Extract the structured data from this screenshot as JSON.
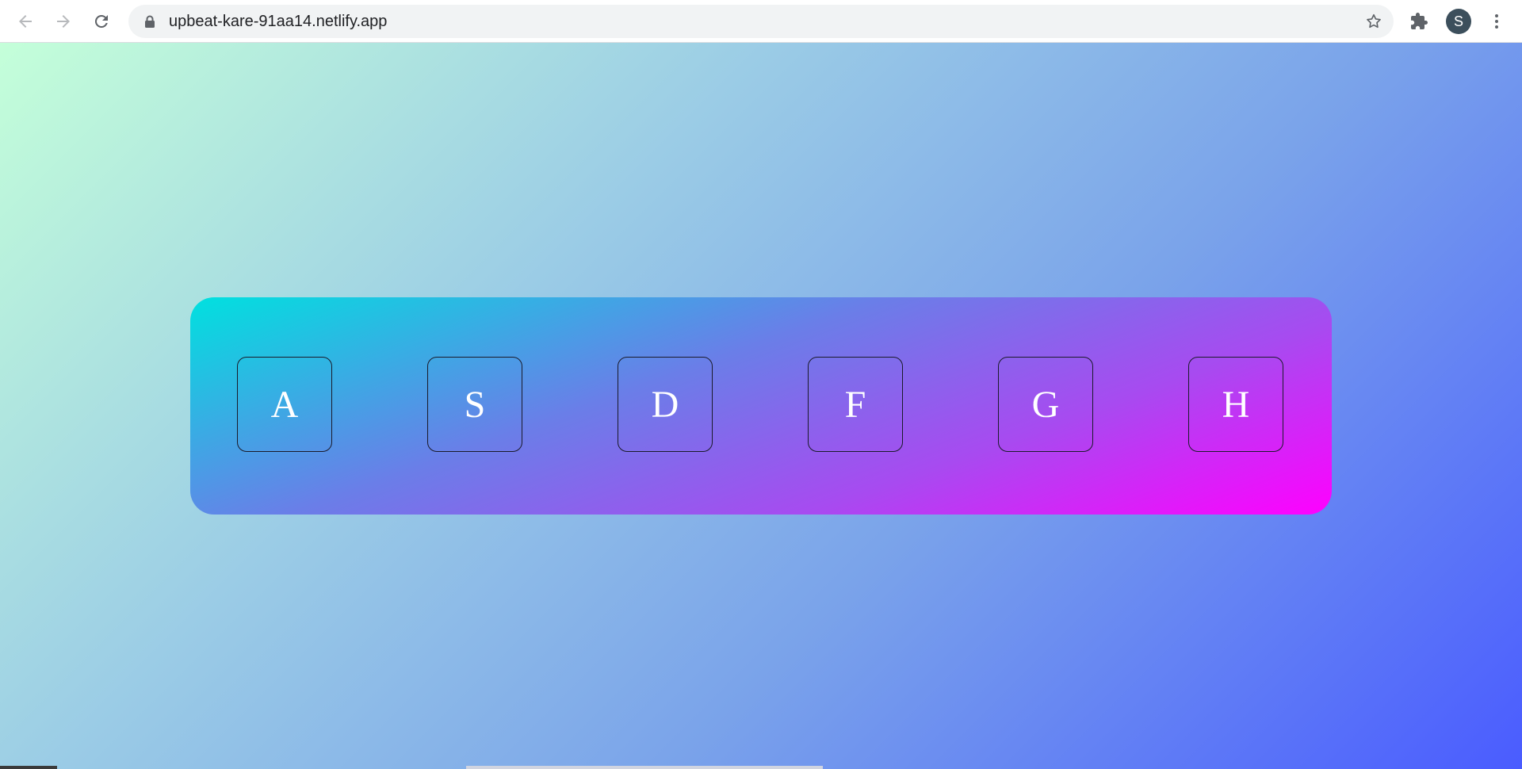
{
  "browser": {
    "url": "upbeat-kare-91aa14.netlify.app",
    "profile_initial": "S"
  },
  "keyboard": {
    "keys": [
      "A",
      "S",
      "D",
      "F",
      "G",
      "H"
    ]
  },
  "colors": {
    "page_gradient_start": "#c4ffd9",
    "page_gradient_end": "#4a5cff",
    "panel_gradient_start": "#00e1df",
    "panel_gradient_end": "#ff00ff"
  }
}
